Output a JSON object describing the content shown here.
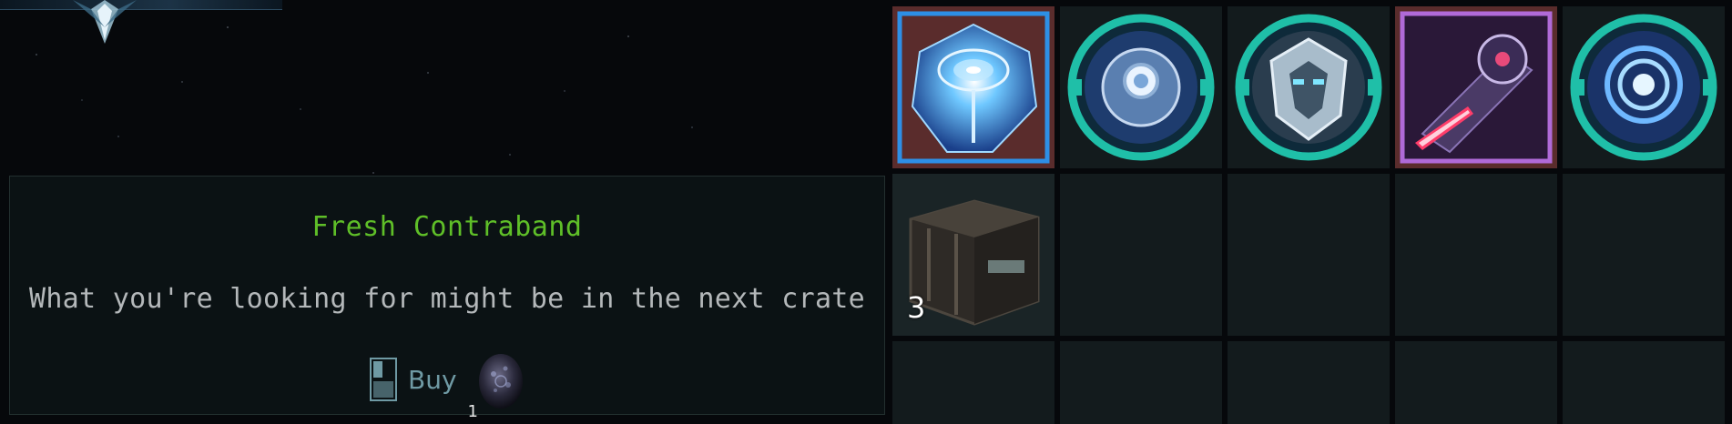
{
  "offer": {
    "title": "Fresh Contraband",
    "description": "What you're looking for might be in the next crate",
    "buy_label": "Buy",
    "cost_quantity": "1"
  },
  "inventory": {
    "slots": [
      {
        "item": "crystal-core-icon",
        "frame": "blue",
        "quantity": ""
      },
      {
        "item": "turret-module-icon",
        "frame": "teal",
        "quantity": ""
      },
      {
        "item": "armor-module-icon",
        "frame": "teal",
        "quantity": ""
      },
      {
        "item": "laser-weapon-icon",
        "frame": "purple",
        "quantity": ""
      },
      {
        "item": "vortex-module-icon",
        "frame": "teal",
        "quantity": ""
      },
      {
        "item": "cargo-crate-icon",
        "frame": "none",
        "quantity": "3"
      }
    ]
  },
  "colors": {
    "title_green": "#5fbf28",
    "text_gray": "#b4b8ba",
    "buy_blue": "#6f9aa4",
    "slot_bg": "#131b1d",
    "rare_frame": "#5a2c2c",
    "teal_ring": "#1fbfa8",
    "blue_frame": "#2d8fe6",
    "purple_frame": "#b06ad8"
  }
}
